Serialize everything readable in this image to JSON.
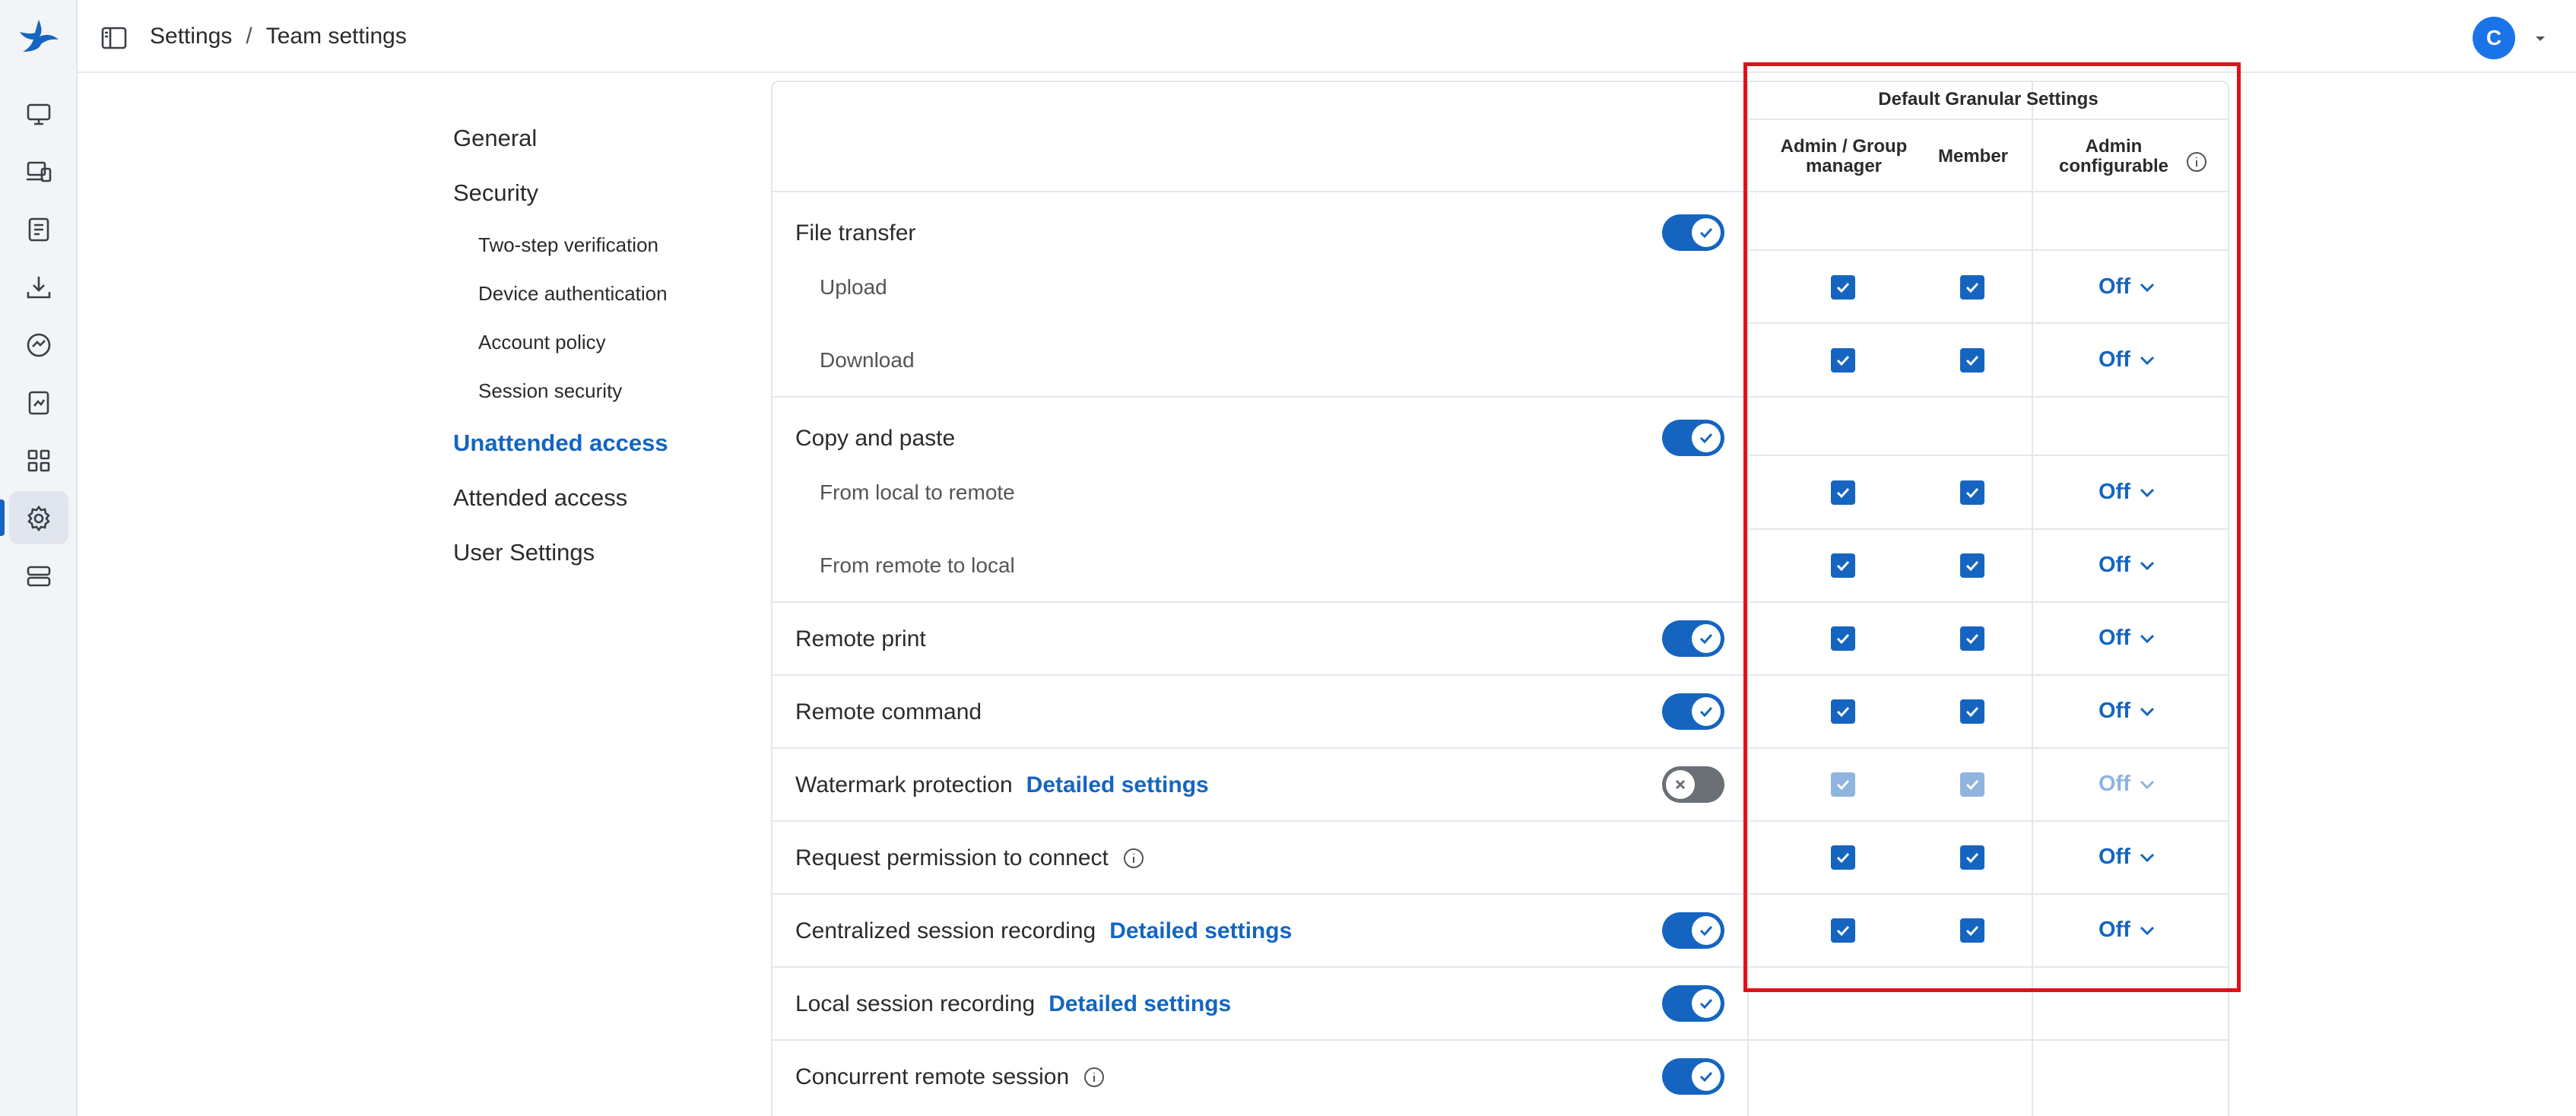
{
  "breadcrumb": {
    "root": "Settings",
    "separator": "/",
    "current": "Team settings"
  },
  "user": {
    "avatar_initial": "C"
  },
  "rail_icons": [
    "logo-icon",
    "monitor-icon",
    "devices-icon",
    "document-icon",
    "download-icon",
    "analytics-icon",
    "report-icon",
    "apps-grid-icon",
    "gear-icon",
    "server-icon"
  ],
  "nav": {
    "general": "General",
    "security": "Security",
    "two_step": "Two-step verification",
    "device_auth": "Device authentication",
    "account_policy": "Account policy",
    "session_security": "Session security",
    "unattended": "Unattended access",
    "attended": "Attended access",
    "user_settings": "User Settings"
  },
  "table": {
    "group_header": "Default Granular Settings",
    "col_admin": "Admin / Group manager",
    "col_member": "Member",
    "col_configurable": "Admin configurable",
    "detailed_link": "Detailed settings",
    "off_label": "Off",
    "rows": {
      "file_transfer": "File transfer",
      "upload": "Upload",
      "download": "Download",
      "copy_paste": "Copy and paste",
      "local_to_remote": "From local to remote",
      "remote_to_local": "From remote to local",
      "remote_print": "Remote print",
      "remote_command": "Remote command",
      "watermark": "Watermark protection",
      "request_permission": "Request permission to connect",
      "central_recording": "Centralized session recording",
      "local_recording": "Local session recording",
      "concurrent": "Concurrent remote session"
    }
  },
  "colors": {
    "accent": "#1565c0",
    "highlight_box": "#e0101b",
    "toggle_off": "#6b6f76"
  }
}
